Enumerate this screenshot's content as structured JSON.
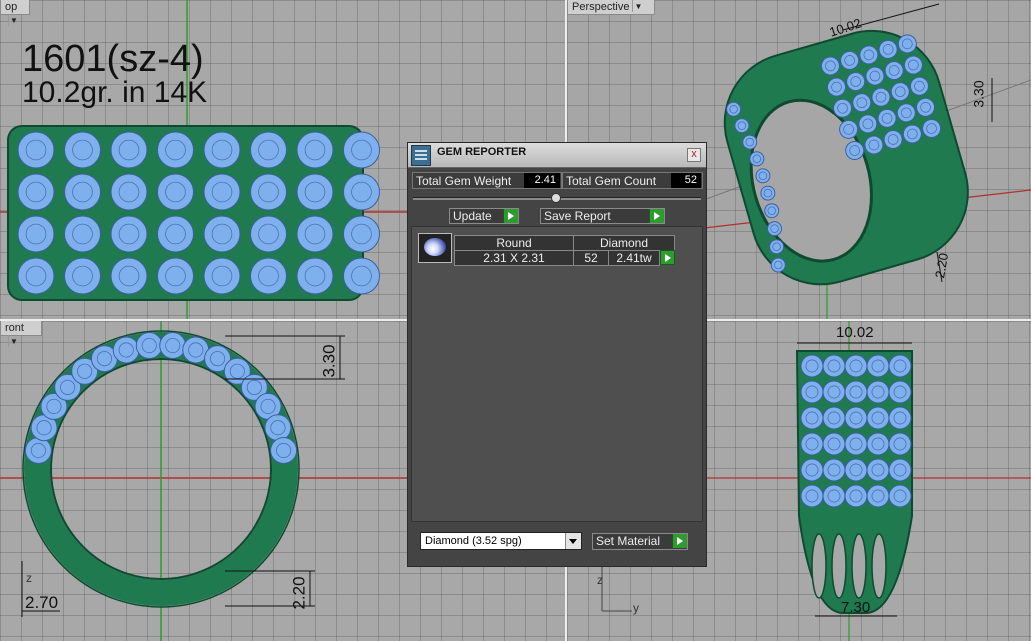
{
  "viewports": {
    "top": {
      "label": "op"
    },
    "perspective": {
      "label": "Perspective"
    },
    "front": {
      "label": "ront"
    }
  },
  "annotations": {
    "model_title": "1601(sz-4)",
    "weight_note": "10.2gr.  in 14K"
  },
  "dimensions": {
    "persp_width": "10.02",
    "persp_height": "3.30",
    "persp_bottom": "2.20",
    "front_top_height": "3.30",
    "front_bottom_height": "2.20",
    "front_bottom_width": "2.70",
    "right_width_top": "10.02",
    "right_width_bottom": "7.30"
  },
  "axes": {
    "front_z": "z",
    "right_z": "z",
    "right_y": "y"
  },
  "gem_reporter": {
    "title": "GEM REPORTER",
    "close": "x",
    "total_weight_label": "Total Gem Weight",
    "total_weight_value": "2.41",
    "total_count_label": "Total Gem Count",
    "total_count_value": "52",
    "update_label": "Update",
    "save_label": "Save Report",
    "gems": [
      {
        "shape": "Round",
        "material": "Diamond",
        "size": "2.31 X 2.31",
        "count": "52",
        "weight": "2.41tw"
      }
    ],
    "material_select": "Diamond    (3.52 spg)",
    "set_material_label": "Set Material"
  },
  "colors": {
    "ring_green": "#1f7a50",
    "gem_blue": "#7fb0ee",
    "viewport_gray": "#a8a8a8",
    "axis_red": "#b03030",
    "axis_green": "#2f9a2f"
  }
}
